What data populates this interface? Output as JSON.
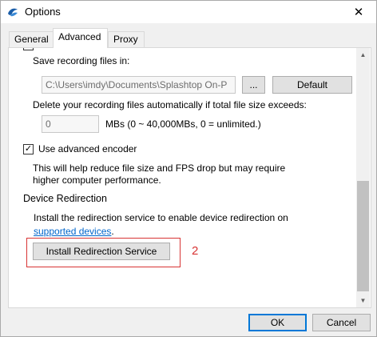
{
  "window": {
    "title": "Options"
  },
  "tabs": [
    {
      "label": "General"
    },
    {
      "label": "Advanced"
    },
    {
      "label": "Proxy"
    }
  ],
  "recording": {
    "save_label": "Save recording files in:",
    "path_value": "C:\\Users\\imdy\\Documents\\Splashtop On-P",
    "browse_label": "...",
    "default_label": "Default",
    "delete_label": "Delete your recording files automatically if total file size exceeds:",
    "size_value": "0",
    "size_unit_label": "MBs (0 ~ 40,000MBs, 0 = unlimited.)"
  },
  "encoder": {
    "checkbox_label": "Use advanced encoder",
    "checked": true,
    "check_glyph": "✓",
    "note_line1": "This will help reduce file size and FPS drop but may require",
    "note_line2": "higher computer performance."
  },
  "device_redirection": {
    "title": "Device Redirection",
    "desc_line1": "Install the redirection service to enable device redirection on",
    "link_text": "supported devices",
    "link_suffix": ".",
    "install_button": "Install Redirection Service"
  },
  "annotation": {
    "marker": "2",
    "color": "#d83434"
  },
  "footer": {
    "ok_label": "OK",
    "cancel_label": "Cancel"
  },
  "icons": {
    "app": "splashtop-icon",
    "close": "close-icon",
    "scroll_up": "chevron-up-icon",
    "scroll_down": "chevron-down-icon"
  },
  "close_glyph": "✕",
  "scroll_up_glyph": "▲",
  "scroll_down_glyph": "▼"
}
